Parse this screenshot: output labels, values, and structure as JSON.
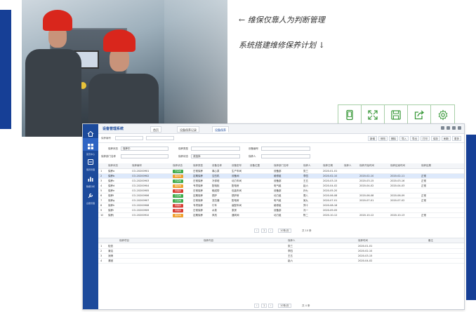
{
  "captions": {
    "line1": "← 维保仅靠人为判断管理",
    "line2": "系统搭建维修保养计划 ↓"
  },
  "colors": {
    "accent": "#163f96",
    "sidebar": "#1c4a9b",
    "status_green": "#3cab4a",
    "status_orange": "#f0a02c",
    "status_red": "#d83a30",
    "icon_green": "#3c9a3c"
  },
  "toolbar_icons": [
    "tablet-icon",
    "expand-icon",
    "save-icon",
    "share-icon",
    "settings-icon"
  ],
  "app": {
    "title": "设备管理系统",
    "tabs": [
      "首页",
      "设备保养记录",
      "设备保养"
    ],
    "sidebar": [
      {
        "label": "首页",
        "icon": "home-icon"
      },
      {
        "label": "首页中心",
        "icon": "grid-icon"
      },
      {
        "label": "保养管理",
        "icon": "device-icon"
      },
      {
        "label": "数据分析",
        "icon": "chart-icon"
      },
      {
        "label": "台账管理",
        "icon": "tool-icon"
      }
    ],
    "filter_label": "保养编号",
    "actions": [
      "新增",
      "修改",
      "删除",
      "导入",
      "导出",
      "打印",
      "保存",
      "刷新",
      "更多"
    ],
    "search": {
      "f1_label": "保养状态",
      "f1_value": "保养中",
      "f2_label": "保养类型",
      "f2_value": "",
      "f3_label": "设备编号",
      "f3_value": "",
      "f4_label": "保养部门名称",
      "f4_value": "",
      "f5_label": "保养状态",
      "f5_value": "请选择",
      "f6_label": "保养人",
      "f6_value": ""
    },
    "columns": [
      "保养状态",
      "保养编号",
      "保养状态",
      "保养类型",
      "设备名称",
      "设备型号",
      "设备位置",
      "保养部门名称",
      "保养人",
      "保养日期",
      "保养人",
      "保养开始时间",
      "保养结束时间",
      "保养结果"
    ],
    "rows": [
      {
        "name": "保养a",
        "code": "CO-20200901",
        "status": "已完成",
        "stype": "green",
        "type": "日常保养",
        "dev": "离心泵",
        "pos": "生产车间",
        "dept": "设备部",
        "who": "张三",
        "date": "2020-01-01",
        "start": "",
        "end": "",
        "res": ""
      },
      {
        "name": "保养b",
        "code": "CO-20200902",
        "status": "保养中",
        "stype": "orange",
        "type": "定期保养",
        "dev": "空压机",
        "pos": "设备间",
        "dept": "维修组",
        "who": "李四",
        "date": "2020-02-10",
        "start": "2020-02-10",
        "end": "2020-02-11",
        "res": "正常"
      },
      {
        "name": "保养c",
        "code": "CO-20200903",
        "status": "已完成",
        "stype": "green",
        "type": "日常保养",
        "dev": "冷却塔",
        "pos": "动力车间",
        "dept": "设备部",
        "who": "王五",
        "date": "2020-03-15",
        "start": "2020-03-15",
        "end": "2020-03-16",
        "res": "正常"
      },
      {
        "name": "保养d",
        "code": "CO-20200904",
        "status": "保养中",
        "stype": "orange",
        "type": "专项保养",
        "dev": "配电柜",
        "pos": "配电房",
        "dept": "电气组",
        "who": "赵六",
        "date": "2020-04-02",
        "start": "2020-04-02",
        "end": "2020-04-03",
        "res": "正常"
      },
      {
        "name": "保养e",
        "code": "CO-20200905",
        "status": "待保养",
        "stype": "red",
        "type": "日常保养",
        "dev": "输送带",
        "pos": "包装车间",
        "dept": "设备部",
        "who": "孙七",
        "date": "2020-05-20",
        "start": "",
        "end": "",
        "res": ""
      },
      {
        "name": "保养f",
        "code": "CO-20200906",
        "status": "已完成",
        "stype": "green",
        "type": "定期保养",
        "dev": "锅炉",
        "pos": "锅炉房",
        "dept": "动力组",
        "who": "周八",
        "date": "2020-06-08",
        "start": "2020-06-08",
        "end": "2020-06-09",
        "res": "正常"
      },
      {
        "name": "保养g",
        "code": "CO-20200907",
        "status": "已完成",
        "stype": "green",
        "type": "日常保养",
        "dev": "变压器",
        "pos": "配电房",
        "dept": "电气组",
        "who": "吴九",
        "date": "2020-07-01",
        "start": "2020-07-01",
        "end": "2020-07-02",
        "res": "正常"
      },
      {
        "name": "保养h",
        "code": "CO-20200908",
        "status": "待保养",
        "stype": "red",
        "type": "专项保养",
        "dev": "行车",
        "pos": "装配车间",
        "dept": "维修组",
        "who": "郑十",
        "date": "2020-08-18",
        "start": "",
        "end": "",
        "res": ""
      },
      {
        "name": "保养i",
        "code": "CO-20200909",
        "status": "待保养",
        "stype": "red",
        "type": "日常保养",
        "dev": "水泵",
        "pos": "泵房",
        "dept": "设备部",
        "who": "冯一",
        "date": "2020-09-05",
        "start": "",
        "end": "",
        "res": ""
      },
      {
        "name": "保养j",
        "code": "CO-20200910",
        "status": "保养中",
        "stype": "orange",
        "type": "定期保养",
        "dev": "风机",
        "pos": "通风间",
        "dept": "动力组",
        "who": "陈二",
        "date": "2020-10-12",
        "start": "2020-10-12",
        "end": "2020-10-13",
        "res": "正常"
      }
    ],
    "pager": {
      "page": "1",
      "total": "共 10 条",
      "size": "10条/页"
    },
    "lower_columns": [
      "保养项目",
      "保养内容",
      "保养人",
      "保养时间",
      "备注"
    ],
    "lower_rows": [
      {
        "idx": "1",
        "name": "检查",
        "who": "张三",
        "time": "2020-01-01"
      },
      {
        "idx": "2",
        "name": "清洁",
        "who": "李四",
        "time": "2020-02-10"
      },
      {
        "idx": "3",
        "name": "润滑",
        "who": "王五",
        "time": "2020-03-15"
      },
      {
        "idx": "4",
        "name": "紧固",
        "who": "赵六",
        "time": "2020-04-02"
      }
    ],
    "lower_pager": {
      "page": "1",
      "size": "10条/页",
      "total": "共 4 条"
    }
  }
}
